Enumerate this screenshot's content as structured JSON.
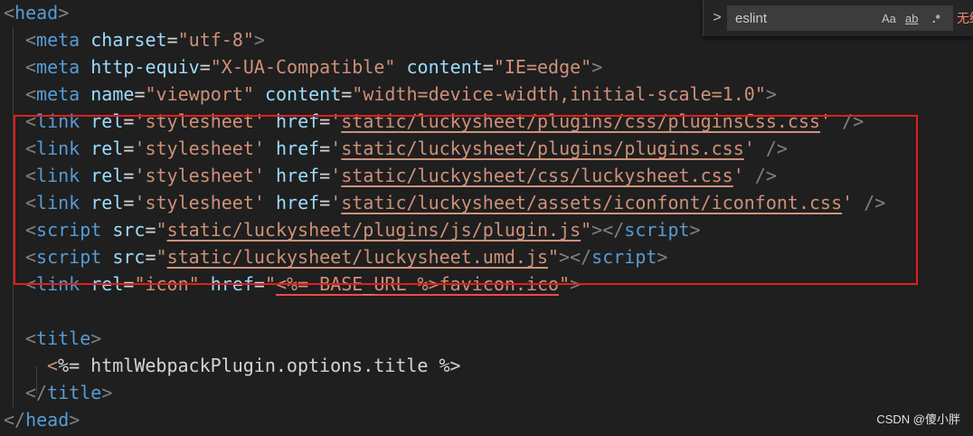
{
  "code_lines": [
    {
      "tokens": [
        [
          "bracket",
          "<"
        ],
        [
          "tag",
          "head"
        ],
        [
          "bracket",
          ">"
        ]
      ]
    },
    {
      "tokens": [
        [
          "bracket",
          "<"
        ],
        [
          "tag",
          "meta"
        ],
        [
          "text",
          " "
        ],
        [
          "attr",
          "charset"
        ],
        [
          "eq",
          "="
        ],
        [
          "str",
          "\"utf-8\""
        ],
        [
          "bracket",
          ">"
        ]
      ]
    },
    {
      "tokens": [
        [
          "bracket",
          "<"
        ],
        [
          "tag",
          "meta"
        ],
        [
          "text",
          " "
        ],
        [
          "attr",
          "http-equiv"
        ],
        [
          "eq",
          "="
        ],
        [
          "str",
          "\"X-UA-Compatible\""
        ],
        [
          "text",
          " "
        ],
        [
          "attr",
          "content"
        ],
        [
          "eq",
          "="
        ],
        [
          "str",
          "\"IE=edge\""
        ],
        [
          "bracket",
          ">"
        ]
      ]
    },
    {
      "tokens": [
        [
          "bracket",
          "<"
        ],
        [
          "tag",
          "meta"
        ],
        [
          "text",
          " "
        ],
        [
          "attr",
          "name"
        ],
        [
          "eq",
          "="
        ],
        [
          "str",
          "\"viewport\""
        ],
        [
          "text",
          " "
        ],
        [
          "attr",
          "content"
        ],
        [
          "eq",
          "="
        ],
        [
          "str",
          "\"width=device-width,initial-scale=1.0\""
        ],
        [
          "bracket",
          ">"
        ]
      ]
    },
    {
      "tokens": [
        [
          "bracket",
          "<"
        ],
        [
          "tag",
          "link"
        ],
        [
          "text",
          " "
        ],
        [
          "attr",
          "rel"
        ],
        [
          "eq",
          "="
        ],
        [
          "str",
          "'stylesheet'"
        ],
        [
          "text",
          " "
        ],
        [
          "attr",
          "href"
        ],
        [
          "eq",
          "="
        ],
        [
          "str",
          "'"
        ],
        [
          "strul",
          "static/luckysheet/plugins/css/pluginsCss.css"
        ],
        [
          "str",
          "'"
        ],
        [
          "text",
          " "
        ],
        [
          "bracket",
          "/>"
        ]
      ]
    },
    {
      "tokens": [
        [
          "bracket",
          "<"
        ],
        [
          "tag",
          "link"
        ],
        [
          "text",
          " "
        ],
        [
          "attr",
          "rel"
        ],
        [
          "eq",
          "="
        ],
        [
          "str",
          "'stylesheet'"
        ],
        [
          "text",
          " "
        ],
        [
          "attr",
          "href"
        ],
        [
          "eq",
          "="
        ],
        [
          "str",
          "'"
        ],
        [
          "strul",
          "static/luckysheet/plugins/plugins.css"
        ],
        [
          "str",
          "'"
        ],
        [
          "text",
          " "
        ],
        [
          "bracket",
          "/>"
        ]
      ]
    },
    {
      "tokens": [
        [
          "bracket",
          "<"
        ],
        [
          "tag",
          "link"
        ],
        [
          "text",
          " "
        ],
        [
          "attr",
          "rel"
        ],
        [
          "eq",
          "="
        ],
        [
          "str",
          "'stylesheet'"
        ],
        [
          "text",
          " "
        ],
        [
          "attr",
          "href"
        ],
        [
          "eq",
          "="
        ],
        [
          "str",
          "'"
        ],
        [
          "strul",
          "static/luckysheet/css/luckysheet.css"
        ],
        [
          "str",
          "'"
        ],
        [
          "text",
          " "
        ],
        [
          "bracket",
          "/>"
        ]
      ]
    },
    {
      "tokens": [
        [
          "bracket",
          "<"
        ],
        [
          "tag",
          "link"
        ],
        [
          "text",
          " "
        ],
        [
          "attr",
          "rel"
        ],
        [
          "eq",
          "="
        ],
        [
          "str",
          "'stylesheet'"
        ],
        [
          "text",
          " "
        ],
        [
          "attr",
          "href"
        ],
        [
          "eq",
          "="
        ],
        [
          "str",
          "'"
        ],
        [
          "strul",
          "static/luckysheet/assets/iconfont/iconfont.css"
        ],
        [
          "str",
          "'"
        ],
        [
          "text",
          " "
        ],
        [
          "bracket",
          "/>"
        ]
      ]
    },
    {
      "tokens": [
        [
          "bracket",
          "<"
        ],
        [
          "tag",
          "script"
        ],
        [
          "text",
          " "
        ],
        [
          "attr",
          "src"
        ],
        [
          "eq",
          "="
        ],
        [
          "str",
          "\""
        ],
        [
          "strul",
          "static/luckysheet/plugins/js/plugin.js"
        ],
        [
          "str",
          "\""
        ],
        [
          "bracket",
          "></"
        ],
        [
          "tag",
          "script"
        ],
        [
          "bracket",
          ">"
        ]
      ]
    },
    {
      "tokens": [
        [
          "bracket",
          "<"
        ],
        [
          "tag",
          "script"
        ],
        [
          "text",
          " "
        ],
        [
          "attr",
          "src"
        ],
        [
          "eq",
          "="
        ],
        [
          "str",
          "\""
        ],
        [
          "strul",
          "static/luckysheet/luckysheet.umd.js"
        ],
        [
          "str",
          "\""
        ],
        [
          "bracket",
          "></"
        ],
        [
          "tag",
          "script"
        ],
        [
          "bracket",
          ">"
        ]
      ]
    },
    {
      "tokens": [
        [
          "bracket",
          "<"
        ],
        [
          "tag",
          "link"
        ],
        [
          "text",
          " "
        ],
        [
          "attr",
          "rel"
        ],
        [
          "eq",
          "="
        ],
        [
          "str",
          "\"icon\""
        ],
        [
          "text",
          " "
        ],
        [
          "attr",
          "href"
        ],
        [
          "eq",
          "="
        ],
        [
          "str",
          "\""
        ],
        [
          "strul",
          "<%= BASE_URL %>favicon.ico"
        ],
        [
          "str",
          "\""
        ],
        [
          "bracket",
          ">"
        ]
      ]
    },
    {
      "tokens": []
    },
    {
      "tokens": [
        [
          "bracket",
          "<"
        ],
        [
          "tag",
          "title"
        ],
        [
          "bracket",
          ">"
        ]
      ]
    },
    {
      "tokens": [
        [
          "bracket",
          "<"
        ],
        [
          "text",
          "%= htmlWebpackPlugin.options.title %>"
        ]
      ]
    },
    {
      "tokens": [
        [
          "bracket",
          "</"
        ],
        [
          "tag",
          "title"
        ],
        [
          "bracket",
          ">"
        ]
      ]
    },
    {
      "tokens": [
        [
          "bracket",
          "</"
        ],
        [
          "tag",
          "head"
        ],
        [
          "bracket",
          ">"
        ]
      ]
    }
  ],
  "find_widget": {
    "toggle_glyph": ">",
    "query": "eslint",
    "match_case_label": "Aa",
    "whole_word_label": "ab",
    "regex_label": ".*",
    "status_text": "无结果"
  },
  "watermark": "CSDN @傻小胖"
}
